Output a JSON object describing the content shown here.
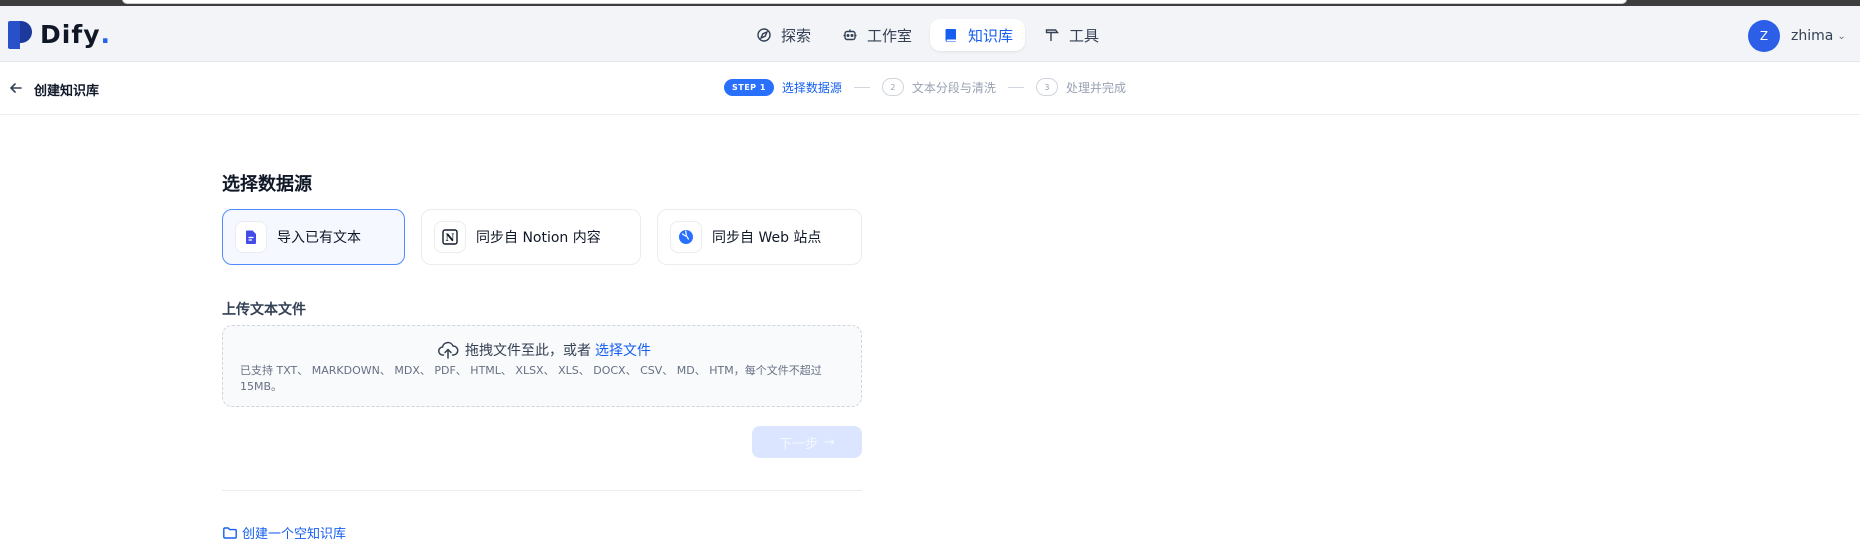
{
  "app": {
    "name": "Dify",
    "logo_suffix": "."
  },
  "nav": {
    "items": [
      {
        "label": "探索",
        "icon": "compass-icon",
        "active": false
      },
      {
        "label": "工作室",
        "icon": "robot-icon",
        "active": false
      },
      {
        "label": "知识库",
        "icon": "book-icon",
        "active": true
      },
      {
        "label": "工具",
        "icon": "hammer-icon",
        "active": false
      }
    ]
  },
  "user": {
    "initial": "Z",
    "name": "zhima"
  },
  "subheader": {
    "title": "创建知识库"
  },
  "steps": {
    "step1_badge": "STEP 1",
    "step1_label": "选择数据源",
    "step2_num": "2",
    "step2_label": "文本分段与清洗",
    "step3_num": "3",
    "step3_label": "处理并完成"
  },
  "source": {
    "title": "选择数据源",
    "options": [
      {
        "label": "导入已有文本",
        "icon": "file-text-icon",
        "selected": true
      },
      {
        "label": "同步自 Notion 内容",
        "icon": "notion-icon",
        "selected": false
      },
      {
        "label": "同步自 Web 站点",
        "icon": "globe-icon",
        "selected": false
      }
    ]
  },
  "upload": {
    "title": "上传文本文件",
    "drag_text": "拖拽文件至此，或者",
    "link_text": "选择文件",
    "hint": "已支持 TXT、 MARKDOWN、 MDX、 PDF、 HTML、 XLSX、 XLS、 DOCX、 CSV、 MD、 HTM，每个文件不超过 15MB。"
  },
  "actions": {
    "next_label": "下一步"
  },
  "empty_kb": {
    "label": "创建一个空知识库"
  },
  "colors": {
    "accent": "#155eef",
    "avatar": "#2c5ee8",
    "disabled_btn": "#dbe5ff"
  }
}
